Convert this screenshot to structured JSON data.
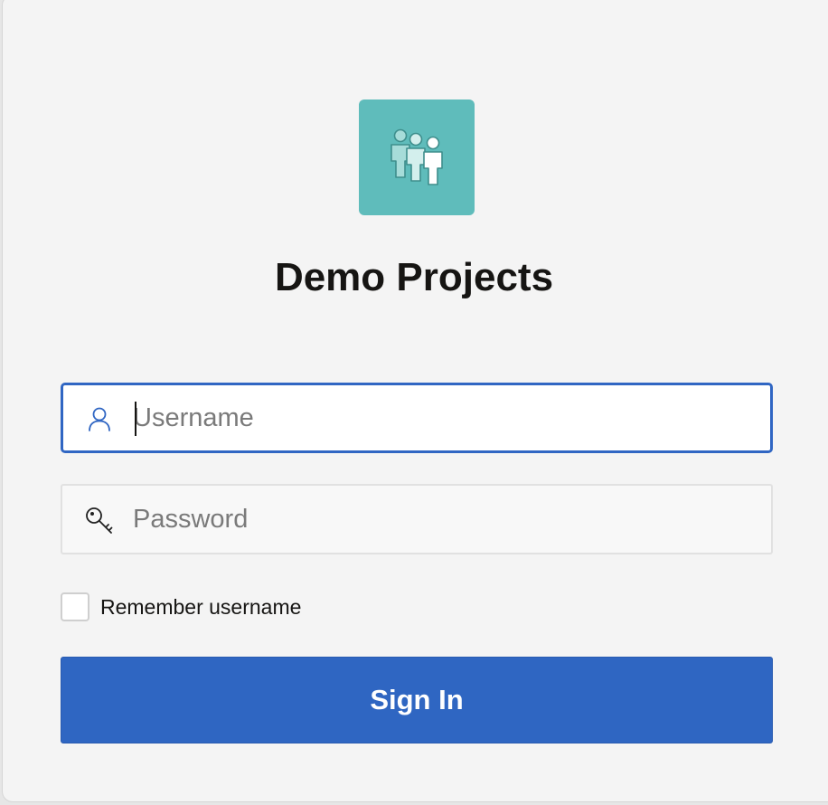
{
  "app": {
    "title": "Demo Projects",
    "logo_icon": "people-group-icon",
    "logo_color": "#5fbcbb"
  },
  "form": {
    "username": {
      "placeholder": "Username",
      "value": "",
      "icon": "user-icon",
      "focused": true
    },
    "password": {
      "placeholder": "Password",
      "value": "",
      "icon": "key-icon"
    },
    "remember": {
      "label": "Remember username",
      "checked": false
    },
    "submit_label": "Sign In"
  },
  "colors": {
    "accent": "#2f66c2",
    "focus_border": "#3066c3",
    "background": "#f4f4f4"
  }
}
